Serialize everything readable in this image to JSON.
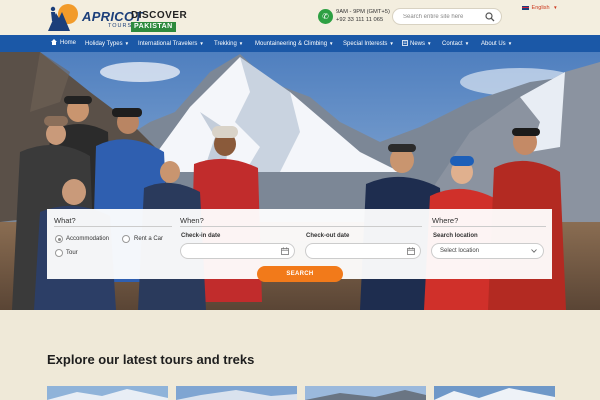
{
  "header": {
    "logo": {
      "brand": "APRICOT",
      "sub": "TOURS",
      "discover": "DISCOVER",
      "country": "PAKISTAN"
    },
    "phone": {
      "hours": "9AM - 9PM (GMT+5)",
      "number": "+92 33 111 11 065",
      "icon": "phone-icon"
    },
    "search": {
      "placeholder": "Search entire site here",
      "icon": "search-icon"
    },
    "language": "English"
  },
  "nav": {
    "items": [
      {
        "label": "Home",
        "icon": "home-icon"
      },
      {
        "label": "Holiday Types"
      },
      {
        "label": "International Travelers"
      },
      {
        "label": "Trekking"
      },
      {
        "label": "Mountaineering & Climbing"
      },
      {
        "label": "Special Interests"
      },
      {
        "label": "News",
        "icon": "newspaper-icon"
      },
      {
        "label": "Contact"
      },
      {
        "label": "About Us"
      }
    ]
  },
  "booking": {
    "what": {
      "label": "What?",
      "options": [
        {
          "label": "Accommodation",
          "checked": true
        },
        {
          "label": "Rent a Car",
          "checked": false
        },
        {
          "label": "Tour",
          "checked": false
        }
      ]
    },
    "when": {
      "label": "When?",
      "checkin_label": "Check-in date",
      "checkout_label": "Check-out date"
    },
    "where": {
      "label": "Where?",
      "location_label": "Search location",
      "location_value": "Select location"
    },
    "search_button": "SEARCH"
  },
  "content": {
    "explore_title": "Explore our latest tours and treks"
  },
  "colors": {
    "nav_bg": "#1b58a7",
    "accent": "#f27a1a",
    "page_bg": "#efe9d8",
    "brand_blue": "#1c3f7a",
    "pakistan_green": "#2e8a3d"
  }
}
